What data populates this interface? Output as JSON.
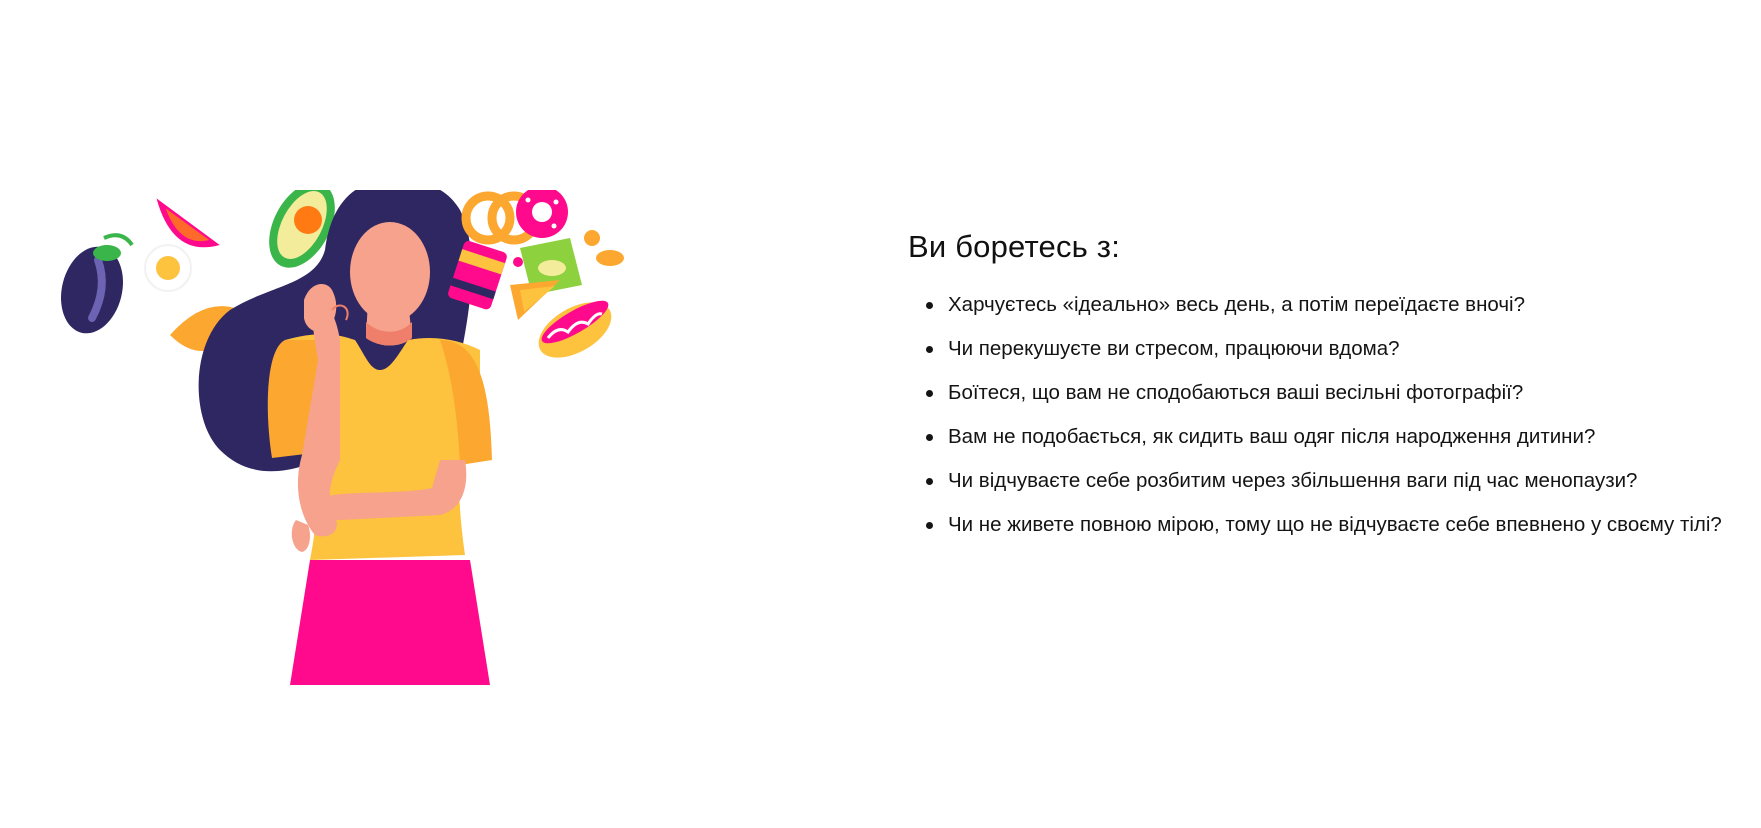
{
  "section": {
    "heading": "Ви боретесь з:",
    "items": [
      "Харчуєтесь «ідеально» весь день, а потім переїдаєте вночі?",
      "Чи перекушуєте ви стресом, працюючи вдома?",
      "Боїтеся, що вам не сподобаються ваші весільні фотографії?",
      "Вам не подобається, як сидить ваш одяг після народження дитини?",
      "Чи відчуваєте себе розбитим через збільшення ваги під час менопаузи?",
      "Чи не живете повною мірою, тому що не відчуваєте себе впевнено у своєму тілі?"
    ]
  },
  "illustration": {
    "subject": "woman-thinking-about-food",
    "food_icons": [
      "eggplant-icon",
      "grapefruit-slice-icon",
      "fried-egg-icon",
      "avocado-icon",
      "croissant-icon",
      "pretzel-icon",
      "soda-can-icon",
      "donut-icon",
      "chips-bag-icon",
      "sandwich-icon",
      "candy-icon",
      "hotdog-icon"
    ],
    "colors": {
      "hair": "#2f2761",
      "skin": "#f6a28d",
      "shirt": "#fdc23e",
      "sleeve": "#fca72f",
      "skirt": "#ff0a8c",
      "neck_shadow": "#ef7f6a"
    }
  }
}
